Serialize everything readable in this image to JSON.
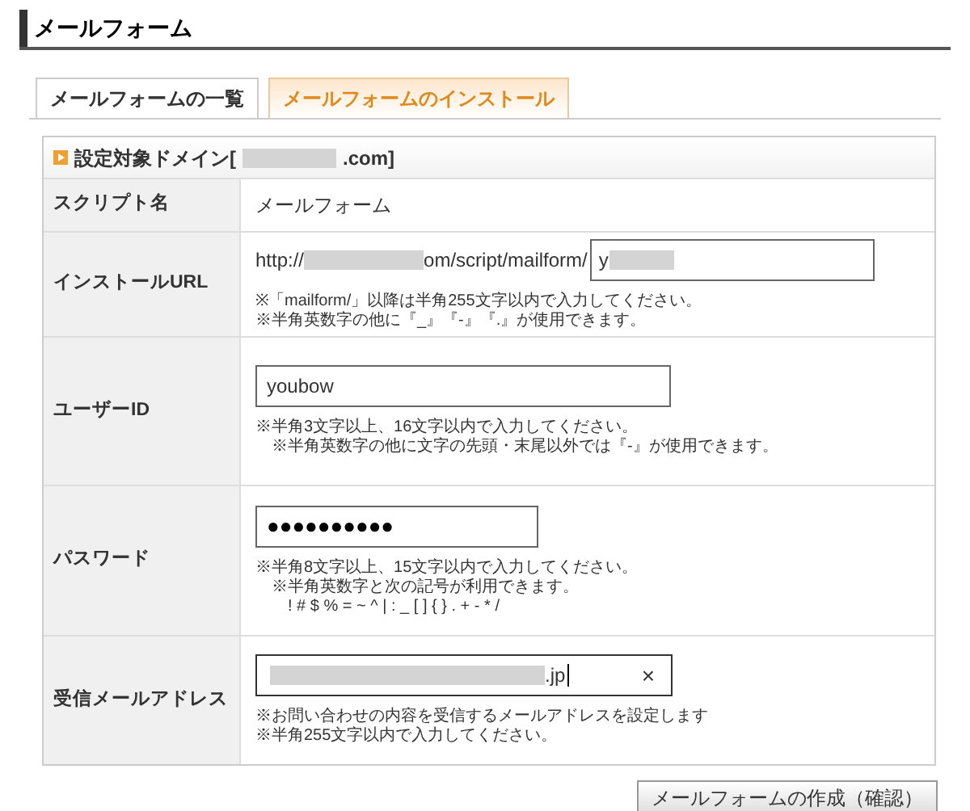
{
  "page_title": "メールフォーム",
  "tabs": [
    {
      "label": "メールフォームの一覧",
      "selected": false
    },
    {
      "label": "メールフォームのインストール",
      "selected": true
    }
  ],
  "section": {
    "prefix": "設定対象ドメイン[",
    "suffix": ".com]"
  },
  "rows": [
    {
      "kind": "text",
      "label": "スクリプト名",
      "value": "メールフォーム"
    },
    {
      "kind": "url",
      "label": "インストールURL",
      "url_prefix": "http://",
      "url_suffix": "om/script/mailform/",
      "value": "y",
      "notes": [
        "※「mailform/」以降は半角255文字以内で入力してください。",
        "※半角英数字の他に『_』『-』『.』が使用できます。"
      ]
    },
    {
      "kind": "input",
      "label": "ユーザーID",
      "value": "youbow",
      "notes": [
        "※半角3文字以上、16文字以内で入力してください。",
        "※半角英数字の他に文字の先頭・末尾以外では『-』が使用できます。"
      ]
    },
    {
      "kind": "password",
      "label": "パスワード",
      "value": "●●●●●●●●●●",
      "notes": [
        "※半角8文字以上、15文字以内で入力してください。",
        "※半角英数字と次の記号が利用できます。",
        "! # $ % = ~ ^ | : _ [ ] { } . + - * /"
      ]
    },
    {
      "kind": "email",
      "label": "受信メールアドレス",
      "value": ".jp",
      "clear": "×",
      "notes": [
        "※お問い合わせの内容を受信するメールアドレスを設定します",
        "※半角255文字以内で入力してください。"
      ]
    }
  ],
  "submit": "メールフォームの作成（確認）"
}
